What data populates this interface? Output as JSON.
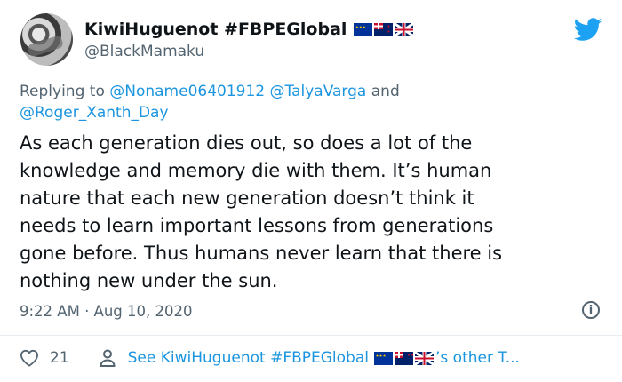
{
  "tweet": {
    "display_name": "KiwiHuguenot #FBPEGlobal",
    "handle": "@BlackMamaku",
    "reply_prefix": "Replying to",
    "reply_mention_1": "@Noname06401912",
    "reply_mention_2": "@TalyaVarga",
    "reply_and": "and",
    "reply_mention_3": "@Roger_Xanth_Day",
    "text": "As each generation dies out, so does a lot of the\nknowledge and memory die with them. It’s human\nnature that each new generation doesn’t think it\nneeds to learn important lessons from generations\ngone before. Thus humans never learn that there is\nnothing new under the sun.",
    "timestamp": "9:22 AM · Aug 10, 2020",
    "likes": "21",
    "see_other_prefix": "See KiwiHuguenot #FBPEGlobal",
    "see_other_suffix": "’s other T...",
    "flags": [
      "eu-flag-icon",
      "nz-flag-icon",
      "uk-flag-icon"
    ]
  },
  "colors": {
    "link": "#1b95e0",
    "muted": "#536471",
    "text": "#0f1419",
    "twitter_blue": "#1da1f2"
  },
  "icons": {
    "logo": "twitter-bird-icon",
    "info": "info-icon",
    "like": "heart-icon",
    "profile": "person-icon"
  }
}
